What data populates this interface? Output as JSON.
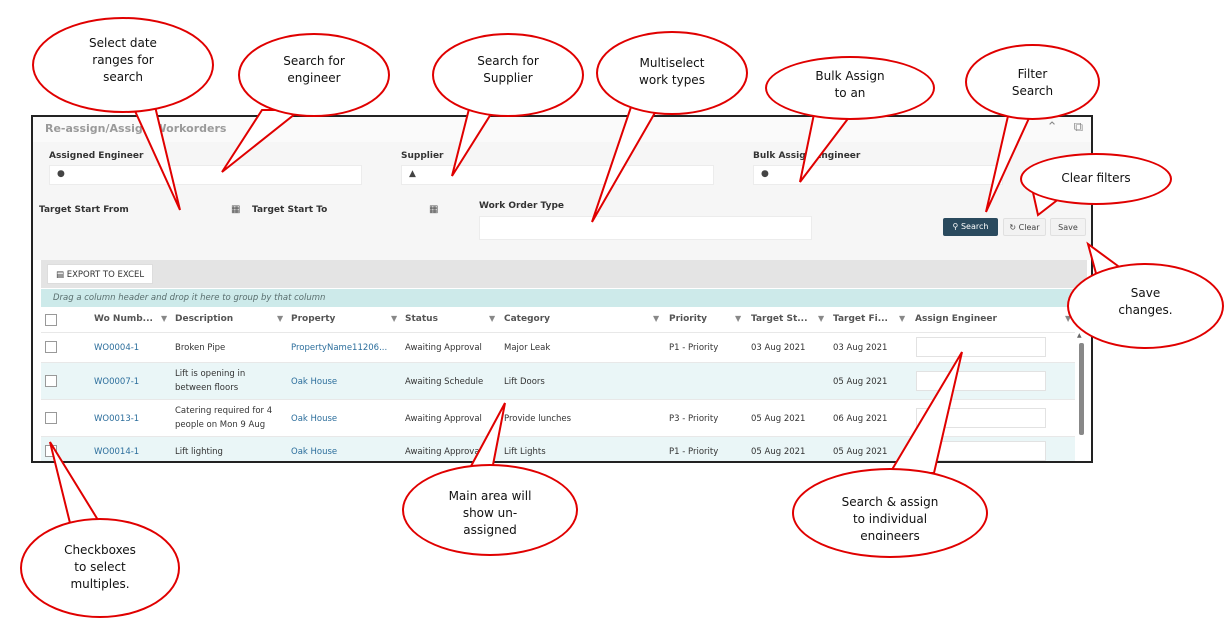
{
  "panel": {
    "title": "Re-assign/Assign Workorders",
    "icons": [
      "chevron-up-icon",
      "external-link-icon"
    ]
  },
  "filters": {
    "assigned_engineer_label": "Assigned Engineer",
    "supplier_label": "Supplier",
    "bulk_assign_label": "Bulk Assign Engineer",
    "target_start_from_label": "Target Start From",
    "target_start_to_label": "Target Start To",
    "work_order_type_label": "Work Order Type"
  },
  "buttons": {
    "search": "Search",
    "clear": "Clear",
    "save": "Save",
    "export": "EXPORT TO EXCEL"
  },
  "grid": {
    "group_hint": "Drag a column header and drop it here to group by that column",
    "columns": [
      "Wo Numb...",
      "Description",
      "Property",
      "Status",
      "Category",
      "Priority",
      "Target St...",
      "Target Fi...",
      "Assign Engineer"
    ],
    "rows": [
      {
        "wo": "WO0004-1",
        "desc1": "Broken Pipe",
        "desc2": "",
        "property": "PropertyName11206...",
        "status": "Awaiting Approval",
        "category": "Major Leak",
        "priority": "P1 - Priority",
        "start": "03 Aug 2021",
        "finish": "03 Aug 2021"
      },
      {
        "wo": "WO0007-1",
        "desc1": "Lift is opening in",
        "desc2": "between floors",
        "property": "Oak House",
        "status": "Awaiting Schedule",
        "category": "Lift Doors",
        "priority": "",
        "start": "",
        "finish": "05 Aug 2021"
      },
      {
        "wo": "WO0013-1",
        "desc1": "Catering required for 4",
        "desc2": "people on Mon 9 Aug",
        "property": "Oak House",
        "status": "Awaiting Approval",
        "category": "Provide lunches",
        "priority": "P3 - Priority",
        "start": "05 Aug 2021",
        "finish": "06 Aug 2021"
      },
      {
        "wo": "WO0014-1",
        "desc1": "Lift lighting",
        "desc2": "",
        "property": "Oak House",
        "status": "Awaiting Approval",
        "category": "Lift Lights",
        "priority": "P1 - Priority",
        "start": "05 Aug 2021",
        "finish": "05 Aug 2021"
      }
    ]
  },
  "callouts": {
    "date_ranges": "Select date\nranges for\nsearch",
    "engineer": "Search for\nengineer",
    "supplier": "Search for\nSupplier",
    "work_types": "Multiselect\nwork types",
    "bulk_assign": "Bulk Assign\nto an",
    "filter_search": "Filter\nSearch",
    "clear_filters": "Clear filters",
    "save_changes": "Save\nchanges.",
    "main_area": "Main area will\nshow un-\nassigned",
    "search_assign": "Search & assign\nto individual\nengineers",
    "checkboxes": "Checkboxes\nto select\nmultiples."
  },
  "colors": {
    "callout_border": "#e00000",
    "search_button": "#2a4a5e",
    "link": "#2c6e9c",
    "row_alt": "#eaf6f7"
  }
}
